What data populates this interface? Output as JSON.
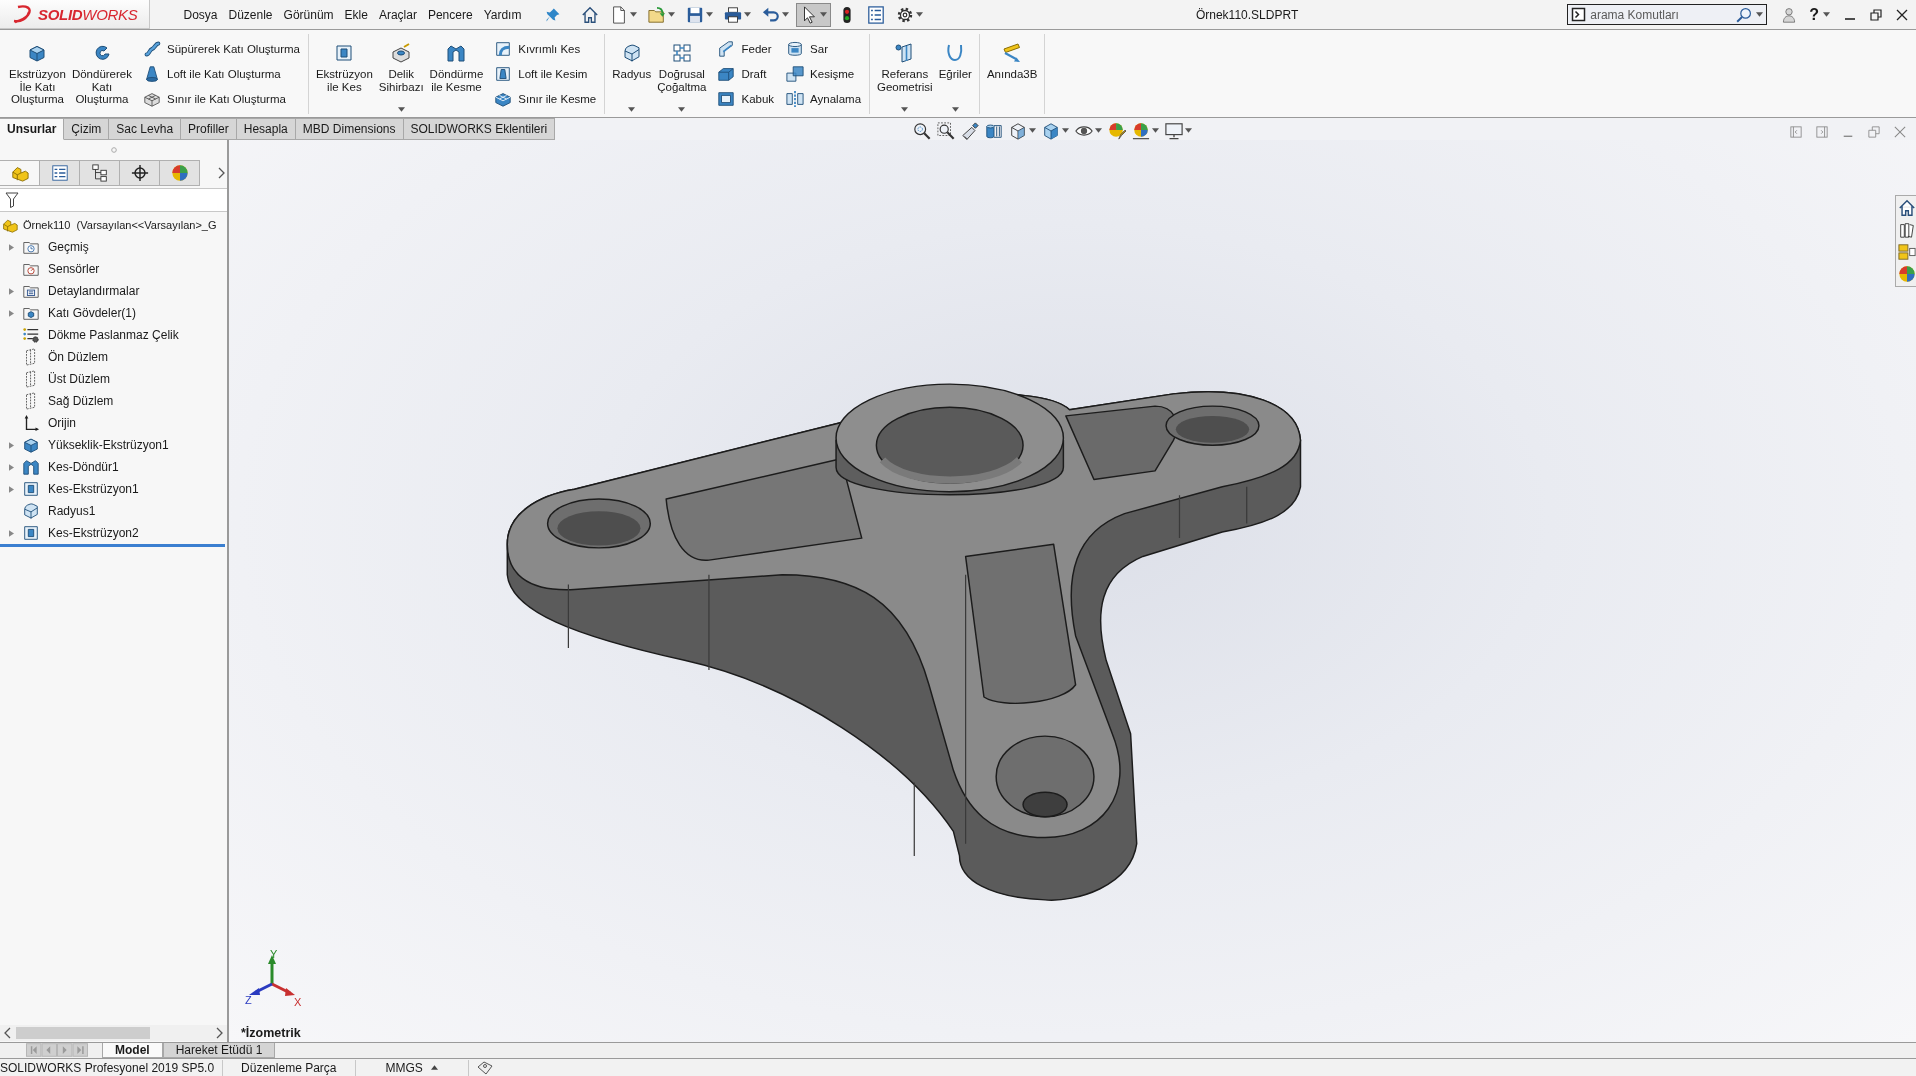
{
  "menu_bar": {
    "logo": "**SOLID**WORKS",
    "items": [
      "Dosya",
      "Düzenle",
      "Görünüm",
      "Ekle",
      "Araçlar",
      "Pencere",
      "Yardım"
    ]
  },
  "quick_access": [
    {
      "kind": "home",
      "dropdown": false,
      "selected": false
    },
    {
      "kind": "new",
      "dropdown": true,
      "selected": false
    },
    {
      "kind": "open",
      "dropdown": true,
      "selected": false
    },
    {
      "kind": "save",
      "dropdown": true,
      "selected": false
    },
    {
      "kind": "print",
      "dropdown": true,
      "selected": false
    },
    {
      "kind": "undo",
      "dropdown": true,
      "selected": false
    },
    {
      "kind": "select",
      "dropdown": true,
      "selected": true
    },
    {
      "kind": "rebuild",
      "dropdown": false,
      "selected": false
    },
    {
      "kind": "file-properties",
      "dropdown": false,
      "selected": false
    },
    {
      "kind": "options",
      "dropdown": true,
      "selected": false
    }
  ],
  "title": "Örnek110.SLDPRT",
  "search": {
    "placeholder": "arama Komutları"
  },
  "help": "?",
  "ribbon": [
    {
      "large": [
        {
          "kind": "extrude",
          "label": "Ekstrüzyon\nİle Katı\nOluşturma",
          "dropdown": false
        },
        {
          "kind": "revolve",
          "label": "Döndürerek\nKatı\nOluşturma",
          "dropdown": false
        }
      ],
      "columns": [
        [
          {
            "kind": "sweep",
            "label": "Süpürerek Katı Oluşturma"
          },
          {
            "kind": "loft",
            "label": "Loft ile Katı Oluşturma"
          },
          {
            "kind": "boundary",
            "label": "Sınır ile Katı Oluşturma"
          }
        ]
      ]
    },
    {
      "large": [
        {
          "kind": "extrude-cut",
          "label": "Ekstrüzyon\nile Kes",
          "dropdown": false
        },
        {
          "kind": "hole",
          "label": "Delik\nSihirbazı",
          "dropdown": true
        },
        {
          "kind": "revolve-cut",
          "label": "Döndürme\nile Kesme",
          "dropdown": false
        }
      ],
      "columns": [
        [
          {
            "kind": "swept-cut",
            "label": "Kıvrımlı Kes"
          },
          {
            "kind": "loft-cut",
            "label": "Loft ile Kesim"
          },
          {
            "kind": "boundary-cut",
            "label": "Sınır ile Kesme"
          }
        ]
      ]
    },
    {
      "large": [
        {
          "kind": "fillet",
          "label": "Radyus",
          "dropdown": true
        },
        {
          "kind": "pattern",
          "label": "Doğrusal\nÇoğaltma",
          "dropdown": true
        }
      ],
      "columns": [
        [
          {
            "kind": "rib",
            "label": "Feder"
          },
          {
            "kind": "draft",
            "label": "Draft"
          },
          {
            "kind": "shell",
            "label": "Kabuk"
          }
        ],
        [
          {
            "kind": "wrap",
            "label": "Sar"
          },
          {
            "kind": "intersect",
            "label": "Kesişme"
          },
          {
            "kind": "mirror",
            "label": "Aynalama"
          }
        ]
      ]
    },
    {
      "large": [
        {
          "kind": "reference",
          "label": "Referans\nGeometrisi",
          "dropdown": true
        },
        {
          "kind": "curves",
          "label": "Eğriler",
          "dropdown": true
        }
      ]
    },
    {
      "large": [
        {
          "kind": "instant3d",
          "label": "Anında3B",
          "dropdown": false
        }
      ]
    }
  ],
  "command_tabs": [
    {
      "label": "Unsurlar",
      "selected": true
    },
    {
      "label": "Çizim",
      "selected": false
    },
    {
      "label": "Sac Levha",
      "selected": false
    },
    {
      "label": "Profiller",
      "selected": false
    },
    {
      "label": "Hesapla",
      "selected": false
    },
    {
      "label": "MBD Dimensions",
      "selected": false
    },
    {
      "label": "SOLIDWORKS Eklentileri",
      "selected": false
    }
  ],
  "view_toolbar": [
    {
      "kind": "zoom-fit",
      "dropdown": false
    },
    {
      "kind": "zoom-area",
      "dropdown": false
    },
    {
      "kind": "previous-view",
      "dropdown": false
    },
    {
      "kind": "section",
      "dropdown": false
    },
    {
      "kind": "orientation",
      "dropdown": true
    },
    {
      "kind": "display-style",
      "dropdown": true
    },
    {
      "kind": "hide-show",
      "dropdown": true
    },
    {
      "kind": "appearance",
      "dropdown": false
    },
    {
      "kind": "scene",
      "dropdown": true
    },
    {
      "kind": "view-settings",
      "dropdown": true
    }
  ],
  "feature_tree": {
    "panel_tabs": [
      {
        "kind": "features",
        "selected": true
      },
      {
        "kind": "properties",
        "selected": false
      },
      {
        "kind": "configurations",
        "selected": false
      },
      {
        "kind": "dimxpert",
        "selected": false
      },
      {
        "kind": "display",
        "selected": false
      }
    ],
    "root": "Örnek110  (Varsayılan<<Varsayılan>_G",
    "items": [
      {
        "kind": "history",
        "label": "Geçmiş",
        "expandable": true
      },
      {
        "kind": "sensors",
        "label": "Sensörler",
        "expandable": false
      },
      {
        "kind": "annotations",
        "label": "Detaylandırmalar",
        "expandable": true
      },
      {
        "kind": "bodies",
        "label": "Katı Gövdeler(1)",
        "expandable": true
      },
      {
        "kind": "material",
        "label": "Dökme Paslanmaz Çelik",
        "expandable": false
      },
      {
        "kind": "plane",
        "label": "Ön Düzlem",
        "expandable": false
      },
      {
        "kind": "plane",
        "label": "Üst Düzlem",
        "expandable": false
      },
      {
        "kind": "plane",
        "label": "Sağ Düzlem",
        "expandable": false
      },
      {
        "kind": "origin",
        "label": "Orijin",
        "expandable": false
      },
      {
        "kind": "boss",
        "label": "Yükseklik-Ekstrüzyon1",
        "expandable": true
      },
      {
        "kind": "revolve-cut",
        "label": "Kes-Döndür1",
        "expandable": true
      },
      {
        "kind": "extrude-cut",
        "label": "Kes-Ekstrüzyon1",
        "expandable": true
      },
      {
        "kind": "fillet",
        "label": "Radyus1",
        "expandable": false
      },
      {
        "kind": "extrude-cut",
        "label": "Kes-Ekstrüzyon2",
        "expandable": true
      }
    ]
  },
  "triad": {
    "x": "X",
    "y": "Y",
    "z": "Z"
  },
  "view_label": "*İzometrik",
  "bottom_tabs": [
    {
      "label": "Model",
      "selected": true
    },
    {
      "label": "Hareket Etüdü 1",
      "selected": false
    }
  ],
  "status_bar": {
    "product": "SOLIDWORKS Profesyonel 2019 SP5.0",
    "mode": "Düzenleme Parça",
    "units": "MMGS"
  }
}
